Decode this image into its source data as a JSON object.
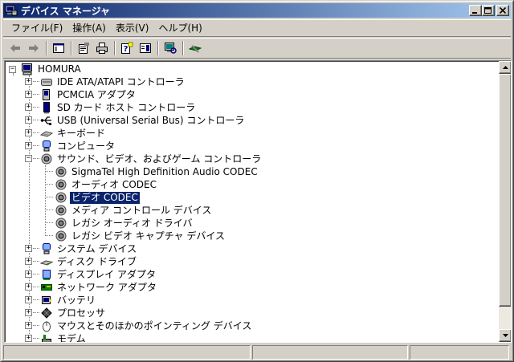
{
  "window": {
    "title": "デバイス マネージャ",
    "controls": {
      "minimize": "_",
      "maximize": "□",
      "close": "✕"
    }
  },
  "menu": [
    {
      "label": "ファイル(F)"
    },
    {
      "label": "操作(A)"
    },
    {
      "label": "表示(V)"
    },
    {
      "label": "ヘルプ(H)"
    }
  ],
  "toolbar": {
    "buttons": [
      "back-icon",
      "forward-icon",
      "show-hide-console-tree-icon",
      "properties-icon",
      "print-icon",
      "help-icon",
      "view-icon",
      "scan-hardware-icon",
      "uninstall-icon"
    ]
  },
  "tree": {
    "root": "HOMURA",
    "items": [
      {
        "label": "IDE ATA/ATAPI コントローラ",
        "icon": "ide-controller-icon",
        "expanded": false
      },
      {
        "label": "PCMCIA アダプタ",
        "icon": "pcmcia-adapter-icon",
        "expanded": false
      },
      {
        "label": "SD カード ホスト コントローラ",
        "icon": "sd-host-icon",
        "expanded": false
      },
      {
        "label": "USB (Universal Serial Bus) コントローラ",
        "icon": "usb-icon",
        "expanded": false
      },
      {
        "label": "キーボード",
        "icon": "keyboard-icon",
        "expanded": false
      },
      {
        "label": "コンピュータ",
        "icon": "computer-icon",
        "expanded": false
      },
      {
        "label": "サウンド、ビデオ、およびゲーム コントローラ",
        "icon": "sound-icon",
        "expanded": true,
        "children": [
          "SigmaTel High Definition Audio CODEC",
          "オーディオ CODEC",
          "ビデオ CODEC",
          "メディア コントロール デバイス",
          "レガシ オーディオ ドライバ",
          "レガシ ビデオ キャプチャ デバイス"
        ],
        "selected_child": 2
      },
      {
        "label": "システム デバイス",
        "icon": "system-device-icon",
        "expanded": false
      },
      {
        "label": "ディスク ドライブ",
        "icon": "disk-drive-icon",
        "expanded": false
      },
      {
        "label": "ディスプレイ アダプタ",
        "icon": "display-adapter-icon",
        "expanded": false
      },
      {
        "label": "ネットワーク アダプタ",
        "icon": "network-adapter-icon",
        "expanded": false
      },
      {
        "label": "バッテリ",
        "icon": "battery-icon",
        "expanded": false
      },
      {
        "label": "プロセッサ",
        "icon": "processor-icon",
        "expanded": false
      },
      {
        "label": "マウスとそのほかのポインティング デバイス",
        "icon": "mouse-icon",
        "expanded": false
      },
      {
        "label": "モデム",
        "icon": "modem-icon",
        "expanded": false
      }
    ]
  },
  "colors": {
    "titlebar_start": "#0a246a",
    "titlebar_end": "#a6caf0",
    "selection": "#0a246a",
    "face": "#d4d0c8"
  }
}
